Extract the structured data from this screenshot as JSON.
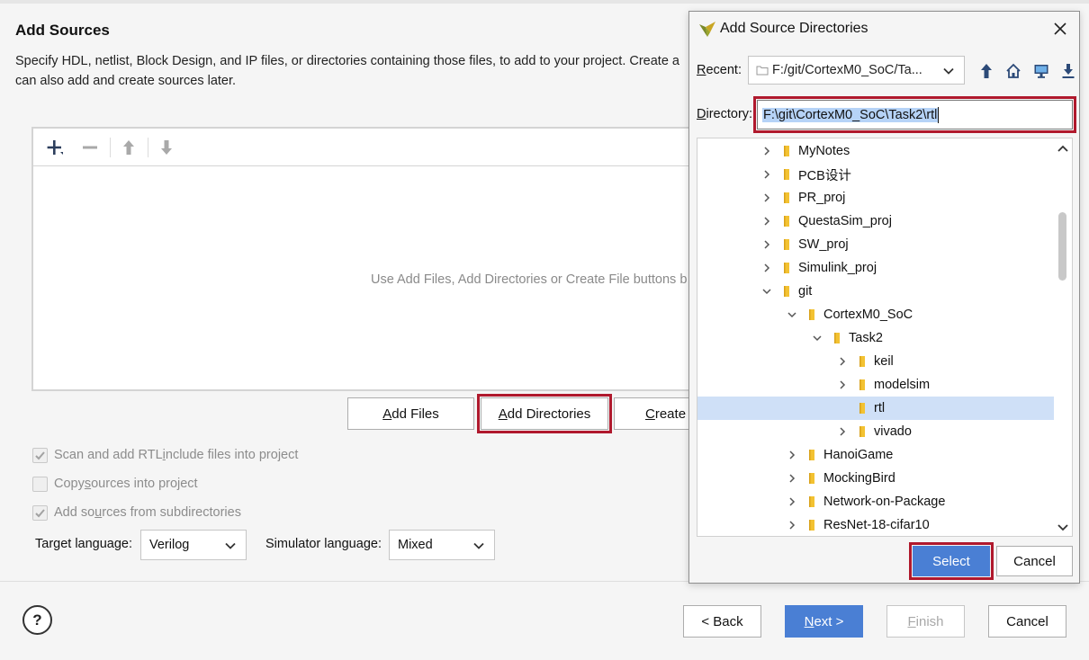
{
  "page": {
    "title": "Add Sources",
    "description_line1": "Specify HDL, netlist, Block Design, and IP files, or directories containing those files, to add to your project. Create a",
    "description_line2": "can also add and create sources later."
  },
  "files_panel": {
    "empty_hint": "Use Add Files, Add Directories or Create File buttons b",
    "toolbar_icons": [
      "add-icon",
      "remove-icon",
      "move-up-icon",
      "move-down-icon"
    ]
  },
  "buttons": {
    "add_files": {
      "pre": "",
      "key": "A",
      "post": "dd Files"
    },
    "add_directories": {
      "pre": "",
      "key": "A",
      "post": "dd Directories"
    },
    "create_file": {
      "pre": "",
      "key": "C",
      "post": "reate"
    }
  },
  "options": {
    "scan_rtl": {
      "label_pre": "Scan and add RTL ",
      "key": "i",
      "label_post": "nclude files into project",
      "checked": true
    },
    "copy_sources": {
      "label_pre": "Copy ",
      "key": "s",
      "label_post": "ources into project",
      "checked": false
    },
    "add_subdirs": {
      "label_pre": "Add so",
      "key": "u",
      "label_post": "rces from subdirectories",
      "checked": true
    }
  },
  "target_language": {
    "label": "Target language:",
    "value": "Verilog"
  },
  "simulator_language": {
    "label": "Simulator language:",
    "value": "Mixed"
  },
  "footer": {
    "help": "?",
    "back": "< Back",
    "next_key": "N",
    "next_rest": "ext >",
    "finish_key": "F",
    "finish_rest": "inish",
    "cancel": "Cancel"
  },
  "dialog": {
    "title": "Add Source Directories",
    "recent_label_key": "R",
    "recent_label_rest": "ecent:",
    "recent_value": "F:/git/CortexM0_SoC/Ta...",
    "directory_label_key": "D",
    "directory_label_rest": "irectory:",
    "directory_value": "F:\\git\\CortexM0_SoC\\Task2\\rtl",
    "nav_icons": [
      "up-folder-icon",
      "home-icon",
      "desktop-icon",
      "download-icon"
    ],
    "tree": [
      {
        "label": "MyNotes",
        "level": 0,
        "expanded": false,
        "selected": false
      },
      {
        "label": "PCB设计",
        "level": 0,
        "expanded": false,
        "selected": false
      },
      {
        "label": "PR_proj",
        "level": 0,
        "expanded": false,
        "selected": false
      },
      {
        "label": "QuestaSim_proj",
        "level": 0,
        "expanded": false,
        "selected": false
      },
      {
        "label": "SW_proj",
        "level": 0,
        "expanded": false,
        "selected": false
      },
      {
        "label": "Simulink_proj",
        "level": 0,
        "expanded": false,
        "selected": false
      },
      {
        "label": "git",
        "level": 0,
        "expanded": true,
        "selected": false
      },
      {
        "label": "CortexM0_SoC",
        "level": 1,
        "expanded": true,
        "selected": false
      },
      {
        "label": "Task2",
        "level": 2,
        "expanded": true,
        "selected": false
      },
      {
        "label": "keil",
        "level": 3,
        "expanded": false,
        "selected": false
      },
      {
        "label": "modelsim",
        "level": 3,
        "expanded": false,
        "selected": false
      },
      {
        "label": "rtl",
        "level": 3,
        "expanded": null,
        "selected": true
      },
      {
        "label": "vivado",
        "level": 3,
        "expanded": false,
        "selected": false
      },
      {
        "label": "HanoiGame",
        "level": 1,
        "expanded": false,
        "selected": false
      },
      {
        "label": "MockingBird",
        "level": 1,
        "expanded": false,
        "selected": false
      },
      {
        "label": "Network-on-Package",
        "level": 1,
        "expanded": false,
        "selected": false
      },
      {
        "label": "ResNet-18-cifar10",
        "level": 1,
        "expanded": false,
        "selected": false
      }
    ],
    "select_button": "Select",
    "cancel_button": "Cancel"
  },
  "colors": {
    "primary": "#4a7fd4",
    "highlight_outline": "#b0192d",
    "selection": "#cfe0f7",
    "folder": "#f3c232"
  }
}
